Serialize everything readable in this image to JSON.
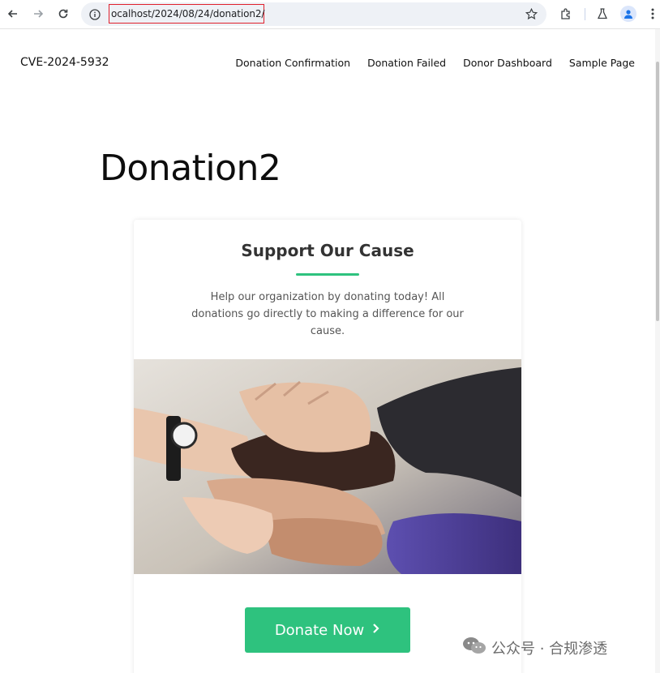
{
  "browser": {
    "url": "ocalhost/2024/08/24/donation2/",
    "icons": [
      "back-icon",
      "forward-icon",
      "reload-icon",
      "info-icon",
      "star-icon",
      "extensions-icon",
      "labs-icon",
      "profile-icon",
      "menu-icon"
    ]
  },
  "site": {
    "title": "CVE-2024-5932",
    "nav": [
      "Donation Confirmation",
      "Donation Failed",
      "Donor Dashboard",
      "Sample Page"
    ]
  },
  "page": {
    "title": "Donation2"
  },
  "card": {
    "title": "Support Our Cause",
    "description": "Help our organization by donating today! All donations go directly to making a difference for our cause.",
    "button_label": "Donate Now",
    "accent_color": "#2ec27e"
  },
  "watermark": {
    "text": "公众号 · 合规渗透"
  }
}
